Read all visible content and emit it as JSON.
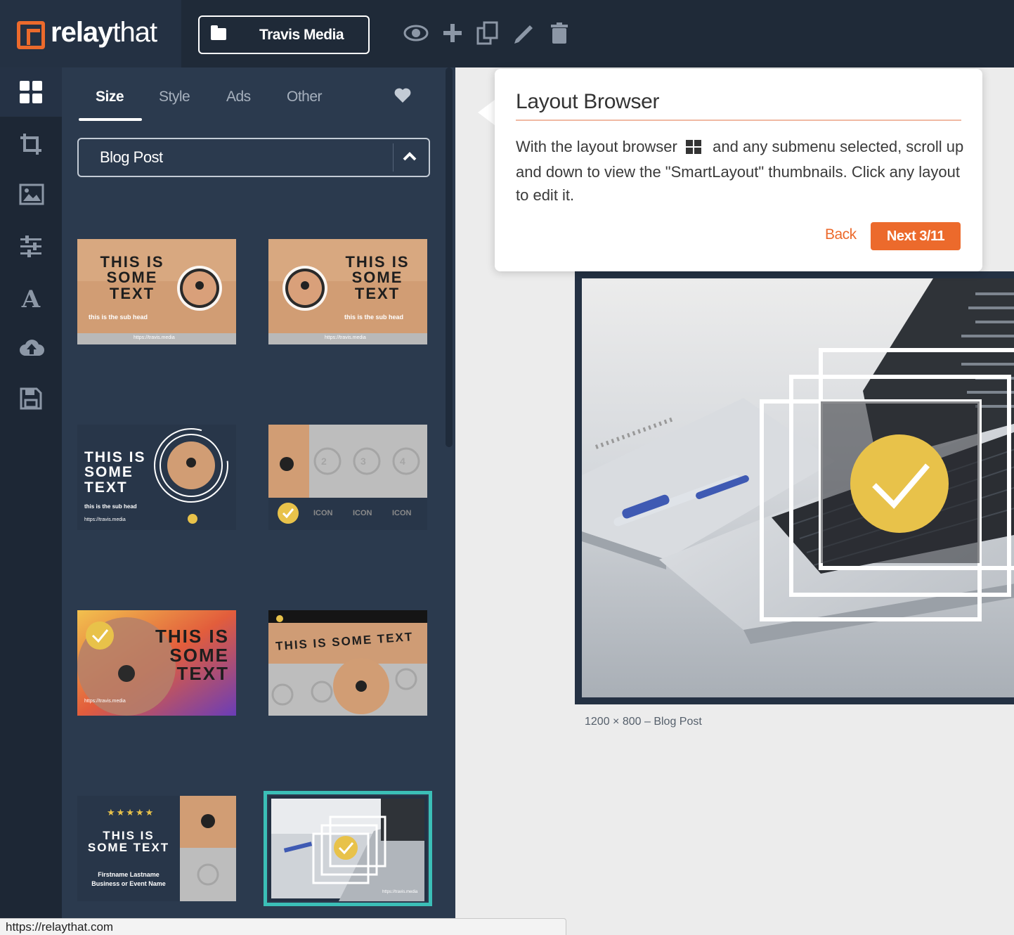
{
  "app": {
    "logo_bold": "relay",
    "logo_light": "that",
    "brand_button": "Travis Media"
  },
  "toolbar": {
    "icons": [
      "eye-icon",
      "plus-icon",
      "duplicate-icon",
      "pencil-icon",
      "trash-icon"
    ]
  },
  "rail": {
    "items": [
      "layout-browser-icon",
      "crop-icon",
      "image-icon",
      "sliders-icon",
      "text-icon",
      "upload-icon",
      "save-icon"
    ],
    "active": "layout-browser-icon"
  },
  "panel": {
    "tabs": [
      "Size",
      "Style",
      "Ads",
      "Other"
    ],
    "active_tab": "Size",
    "size_select": "Blog Post"
  },
  "thumbnails": {
    "headline": "THIS IS SOME TEXT",
    "headline_line1": "THIS IS",
    "headline_line2": "SOME",
    "headline_line3": "TEXT",
    "headline_line23": "SOME TEXT",
    "subline": "this is the sub head",
    "url": "https://travis.media",
    "icon_label": "ICON",
    "stars": "★★★★★",
    "name_line1": "Firstname Lastname",
    "name_line2": "Business or Event Name",
    "num_2": "2",
    "num_3": "3",
    "num_4": "4"
  },
  "tooltip": {
    "title": "Layout Browser",
    "body_part1": "With the layout browser",
    "body_part2": "and any submenu selected, scroll up and down to view the \"SmartLayout\" thumbnails. Click any layout to edit it.",
    "back_label": "Back",
    "next_label": "Next 3/11"
  },
  "canvas": {
    "caption": "1200 × 800 – Blog Post"
  },
  "status_bar": {
    "url": "https://relaythat.com"
  },
  "colors": {
    "accent": "#ec6a2c",
    "dark": "#1f2a38",
    "panel": "#2b3a4e",
    "check": "#e8c24a",
    "selected_outline": "#3bbfb7"
  }
}
